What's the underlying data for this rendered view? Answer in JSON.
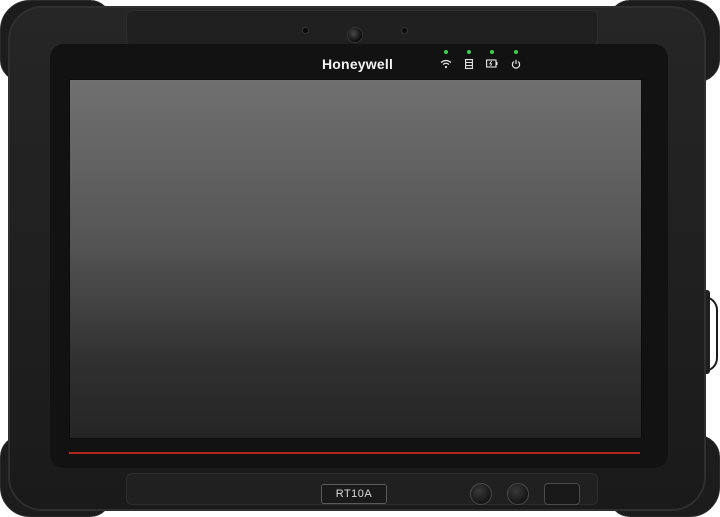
{
  "device": {
    "brand": "Honeywell",
    "model": "RT10A",
    "accent_line_color": "#b3261e",
    "led_color": "#3fd14a",
    "screen_state": "off"
  },
  "status_indicators": [
    {
      "icon": "wifi-icon"
    },
    {
      "icon": "storage-icon"
    },
    {
      "icon": "battery-icon"
    },
    {
      "icon": "power-icon"
    }
  ],
  "buttons": {
    "left_round": "round-button",
    "right_round": "round-button",
    "rect": "rect-button"
  }
}
